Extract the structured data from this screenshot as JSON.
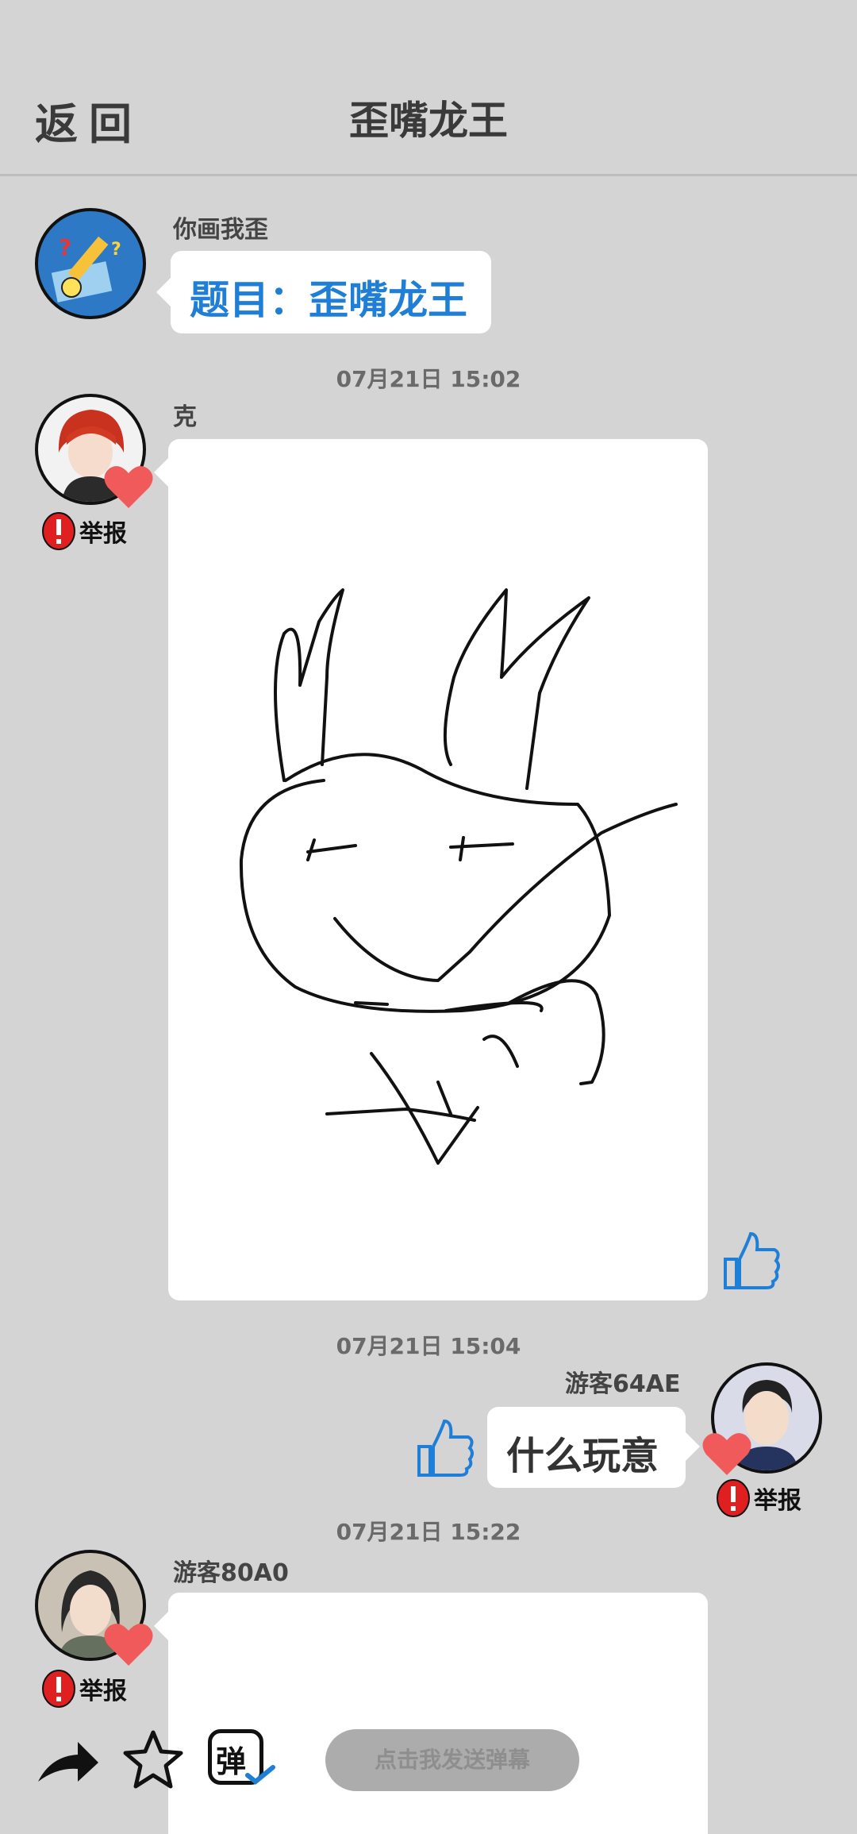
{
  "header": {
    "back_label": "返回",
    "title": "歪嘴龙王"
  },
  "messages": [
    {
      "name": "你画我歪",
      "text": "题目：歪嘴龙王"
    },
    {
      "time": "07月21日 15:02",
      "name": "克",
      "report": "举报"
    },
    {
      "time": "07月21日 15:04",
      "name": "游客64AE",
      "text": "什么玩意",
      "report": "举报"
    },
    {
      "time": "07月21日 15:22",
      "name": "游客80A0",
      "report": "举报"
    }
  ],
  "bottom": {
    "danmu_icon_label": "弹",
    "danmu_placeholder": "点击我发送弹幕"
  },
  "colors": {
    "background": "#d4d4d4",
    "accent_blue": "#1f7fd6",
    "heart_red": "#f05a5a",
    "report_red": "#e02020"
  },
  "icons": [
    "share-arrow-icon",
    "star-icon",
    "danmu-icon",
    "thumbs-up-icon",
    "heart-icon",
    "alert-icon",
    "pencil-icon"
  ]
}
